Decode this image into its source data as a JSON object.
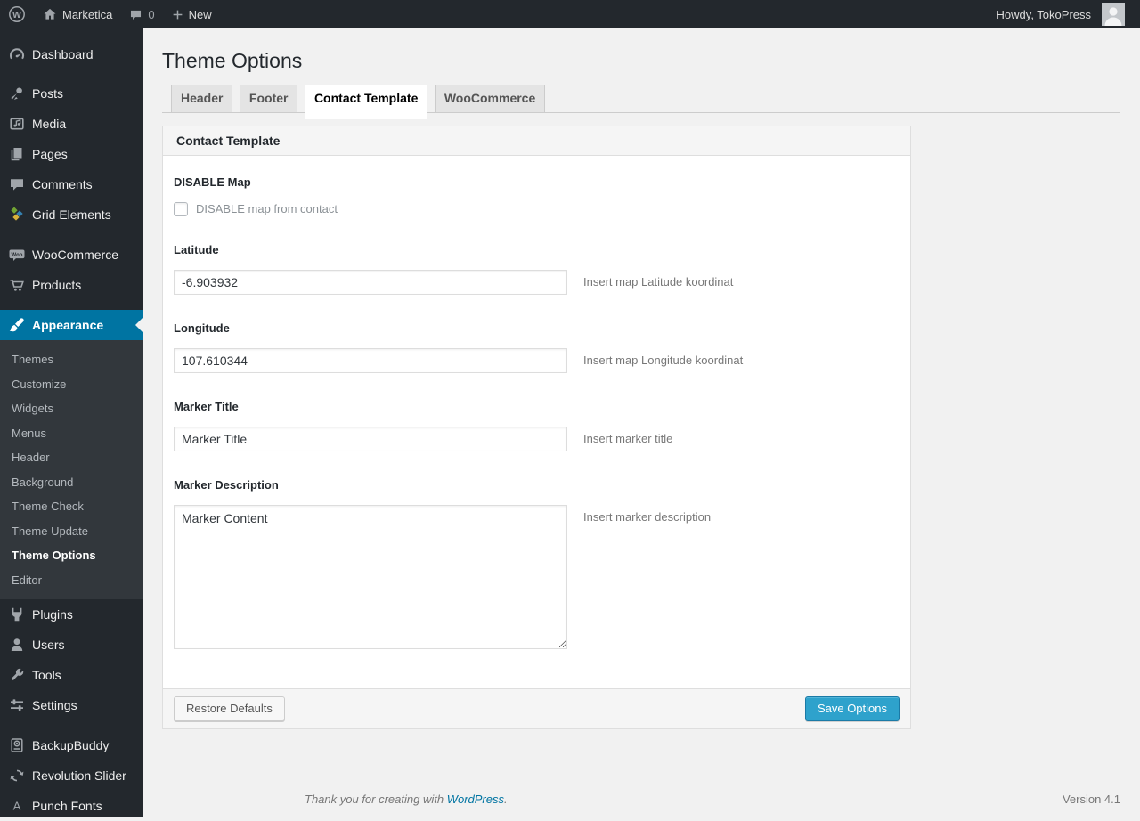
{
  "colors": {
    "accent_blue": "#0074a2",
    "primary_button": "#2ea2cc",
    "admin_dark": "#23282d",
    "submenu_dark": "#32373c",
    "content_bg": "#f1f1f1"
  },
  "admin_bar": {
    "wp_logo_icon": "wordpress-logo-icon",
    "site_name": "Marketica",
    "comments_count": "0",
    "new_label": "New",
    "howdy": "Howdy, TokoPress"
  },
  "sidebar": {
    "items": [
      {
        "label": "Dashboard",
        "icon": "dashboard-icon"
      },
      {
        "label": "Posts",
        "icon": "posts-icon"
      },
      {
        "label": "Media",
        "icon": "media-icon"
      },
      {
        "label": "Pages",
        "icon": "pages-icon"
      },
      {
        "label": "Comments",
        "icon": "comments-icon"
      },
      {
        "label": "Grid Elements",
        "icon": "grid-elements-icon"
      },
      {
        "label": "WooCommerce",
        "icon": "woocommerce-icon"
      },
      {
        "label": "Products",
        "icon": "products-icon"
      },
      {
        "label": "Appearance",
        "icon": "appearance-icon",
        "current": true
      },
      {
        "label": "Plugins",
        "icon": "plugins-icon"
      },
      {
        "label": "Users",
        "icon": "users-icon"
      },
      {
        "label": "Tools",
        "icon": "tools-icon"
      },
      {
        "label": "Settings",
        "icon": "settings-icon"
      },
      {
        "label": "BackupBuddy",
        "icon": "backupbuddy-icon"
      },
      {
        "label": "Revolution Slider",
        "icon": "revolution-slider-icon"
      },
      {
        "label": "Punch Fonts",
        "icon": "punch-fonts-icon"
      }
    ],
    "appearance_submenu": [
      "Themes",
      "Customize",
      "Widgets",
      "Menus",
      "Header",
      "Background",
      "Theme Check",
      "Theme Update",
      "Theme Options",
      "Editor"
    ],
    "current_submenu_item": "Theme Options"
  },
  "page": {
    "title": "Theme Options",
    "tabs": [
      {
        "label": "Header"
      },
      {
        "label": "Footer"
      },
      {
        "label": "Contact Template",
        "active": true
      },
      {
        "label": "WooCommerce"
      }
    ],
    "panel": {
      "title": "Contact Template",
      "fields": {
        "disable_map": {
          "label": "DISABLE Map",
          "checkbox_label": "DISABLE map from contact",
          "checked": false
        },
        "latitude": {
          "label": "Latitude",
          "value": "-6.903932",
          "description": "Insert map Latitude koordinat"
        },
        "longitude": {
          "label": "Longitude",
          "value": "107.610344",
          "description": "Insert map Longitude koordinat"
        },
        "marker_title": {
          "label": "Marker Title",
          "value": "Marker Title",
          "description": "Insert marker title"
        },
        "marker_description": {
          "label": "Marker Description",
          "value": "Marker Content",
          "description": "Insert marker description"
        }
      },
      "buttons": {
        "restore": "Restore Defaults",
        "save": "Save Options"
      }
    },
    "footer": {
      "thanks_prefix": "Thank you for creating with ",
      "link": "WordPress",
      "suffix": ".",
      "version": "Version 4.1"
    }
  }
}
